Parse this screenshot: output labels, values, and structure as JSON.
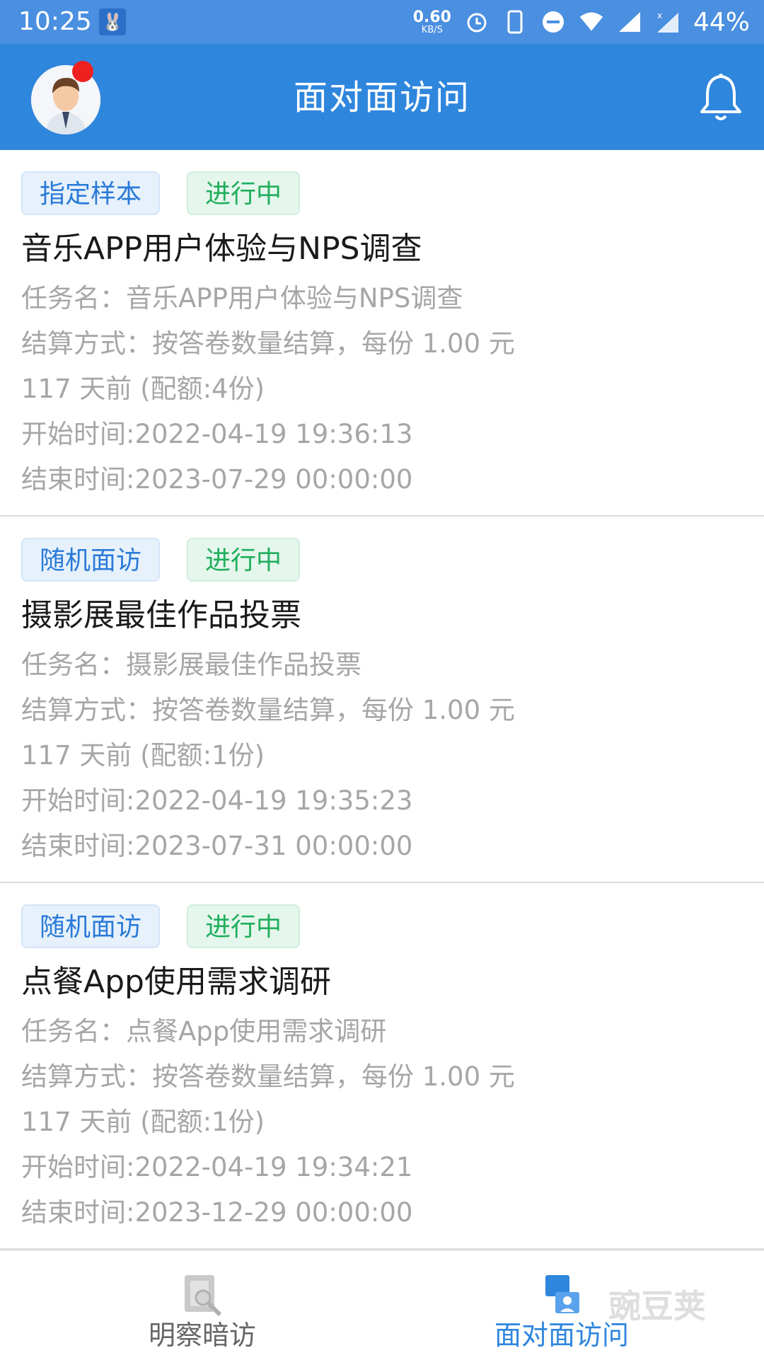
{
  "status_bar": {
    "time": "10:25",
    "net_speed_value": "0.60",
    "net_speed_unit": "KB/S",
    "battery": "44%"
  },
  "app_bar": {
    "title": "面对面访问"
  },
  "tasks": [
    {
      "type_tag": "指定样本",
      "status_tag": "进行中",
      "title": "音乐APP用户体验与NPS调查",
      "task_name": "任务名：音乐APP用户体验与NPS调查",
      "settlement": "结算方式：按答卷数量结算，每份 1.00 元",
      "age_quota": "117 天前 (配额:4份)",
      "start_time": "开始时间:2022-04-19 19:36:13",
      "end_time": "结束时间:2023-07-29 00:00:00"
    },
    {
      "type_tag": "随机面访",
      "status_tag": "进行中",
      "title": "摄影展最佳作品投票",
      "task_name": "任务名：摄影展最佳作品投票",
      "settlement": "结算方式：按答卷数量结算，每份 1.00 元",
      "age_quota": "117 天前 (配额:1份)",
      "start_time": "开始时间:2022-04-19 19:35:23",
      "end_time": "结束时间:2023-07-31 00:00:00"
    },
    {
      "type_tag": "随机面访",
      "status_tag": "进行中",
      "title": "点餐App使用需求调研",
      "task_name": "任务名：点餐App使用需求调研",
      "settlement": "结算方式：按答卷数量结算，每份 1.00 元",
      "age_quota": "117 天前 (配额:1份)",
      "start_time": "开始时间:2022-04-19 19:34:21",
      "end_time": "结束时间:2023-12-29 00:00:00"
    }
  ],
  "bottom_nav": {
    "left_label": "明察暗访",
    "right_label": "面对面访问"
  },
  "watermark": "豌豆荚",
  "colors": {
    "app_bar": "#2f86dd",
    "status_bar": "#4a8fe0",
    "type_tag_text": "#2a7ad8",
    "status_tag_text": "#1fae5c",
    "info_text": "#a6a6a6",
    "nav_active": "#2f86dd"
  }
}
